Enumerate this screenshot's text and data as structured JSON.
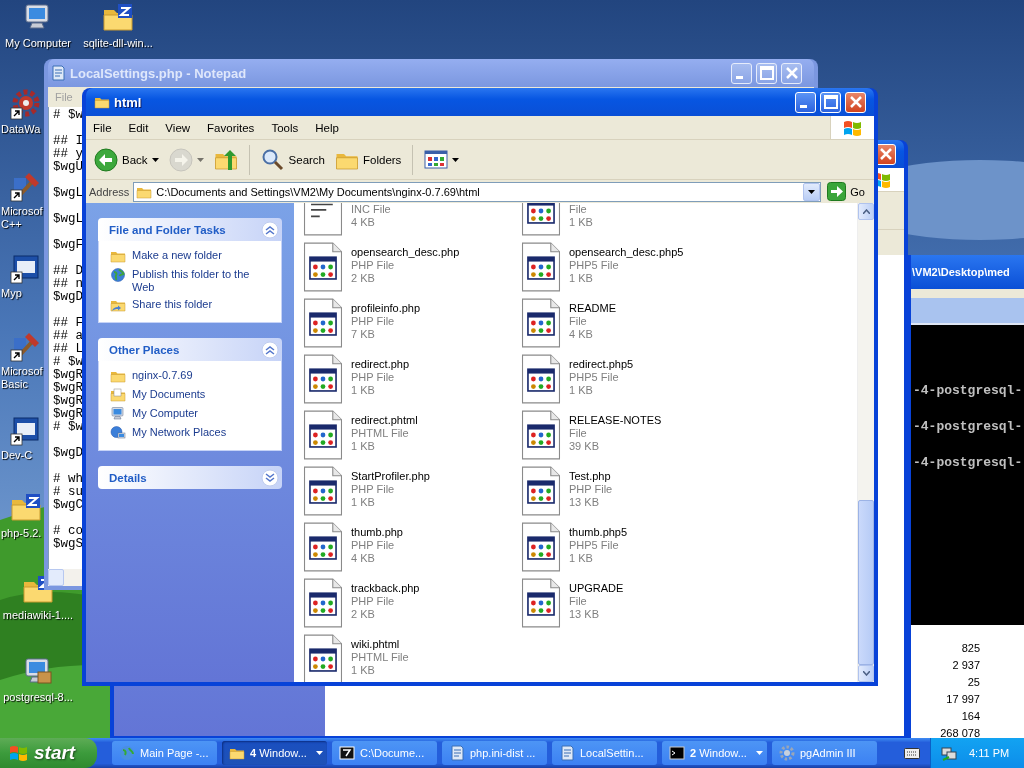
{
  "desktop_icons": [
    {
      "lines": [
        "My Computer"
      ],
      "kind": "computer",
      "shortcut": false
    },
    {
      "lines": [
        "sqlite-dll-win..."
      ],
      "kind": "archive",
      "shortcut": false
    },
    {
      "lines": [
        "DataWa"
      ],
      "kind": "gear",
      "shortcut": true
    },
    {
      "lines": [
        "Microsof",
        "C++"
      ],
      "kind": "tools",
      "shortcut": true
    },
    {
      "lines": [
        "Myp"
      ],
      "kind": "app",
      "shortcut": true
    },
    {
      "lines": [
        "Microsof",
        "Basic"
      ],
      "kind": "tools",
      "shortcut": true
    },
    {
      "lines": [
        "Dev-C"
      ],
      "kind": "app",
      "shortcut": true
    },
    {
      "lines": [
        "php-5.2."
      ],
      "kind": "archive",
      "shortcut": false
    },
    {
      "lines": [
        "mediawiki-1...."
      ],
      "kind": "archive",
      "shortcut": false
    },
    {
      "lines": [
        "postgresql-8..."
      ],
      "kind": "installer",
      "shortcut": false
    }
  ],
  "notepad": {
    "title": "LocalSettings.php - Notepad",
    "active": false,
    "menu": [
      "File"
    ],
    "blocks": [
      [
        "# $w"
      ],
      [
        "## I",
        "## y",
        "$wgU"
      ],
      [
        "$wgL"
      ],
      [
        "$wgL"
      ],
      [
        "$wgF"
      ],
      [
        "## D",
        "## n",
        "$wgD"
      ],
      [
        "## F",
        "## a",
        "## L",
        "# $w",
        "$wgR",
        "$wgR",
        "$wgR",
        "$wgR",
        "# $w"
      ],
      [
        "$wgD"
      ],
      [
        "# wh",
        "# su",
        "$wgC"
      ],
      [
        "# co",
        "$wgS"
      ]
    ]
  },
  "explorer": {
    "title": "html",
    "active": true,
    "menu": [
      "File",
      "Edit",
      "View",
      "Favorites",
      "Tools",
      "Help"
    ],
    "toolbar": [
      {
        "kind": "back",
        "label": "Back",
        "disabled": false
      },
      {
        "kind": "forward",
        "disabled": true
      },
      {
        "kind": "up",
        "disabled": false
      },
      {
        "kind": "search",
        "label": "Search",
        "disabled": false
      },
      {
        "kind": "folders",
        "label": "Folders",
        "disabled": false
      },
      {
        "kind": "views",
        "disabled": false
      }
    ],
    "address": {
      "label": "Address",
      "value": "C:\\Documents and Settings\\VM2\\My Documents\\nginx-0.7.69\\html",
      "go": "Go"
    },
    "task_panels": [
      {
        "title": "File and Folder Tasks",
        "expanded": true,
        "items": [
          {
            "label": "Make a new folder",
            "kind": "new-folder"
          },
          {
            "label": "Publish this folder to the Web",
            "kind": "globe"
          },
          {
            "label": "Share this folder",
            "kind": "share"
          }
        ]
      },
      {
        "title": "Other Places",
        "expanded": true,
        "items": [
          {
            "label": "nginx-0.7.69",
            "kind": "folder"
          },
          {
            "label": "My Documents",
            "kind": "documents"
          },
          {
            "label": "My Computer",
            "kind": "computer"
          },
          {
            "label": "My Network Places",
            "kind": "network"
          }
        ]
      },
      {
        "title": "Details",
        "expanded": false
      }
    ],
    "files": [
      {
        "type": "INC File",
        "size": "4 KB",
        "kind": "text"
      },
      {
        "type": "File",
        "size": "1 KB",
        "kind": "app"
      },
      {
        "name": "opensearch_desc.php",
        "type": "PHP File",
        "size": "2 KB",
        "kind": "app"
      },
      {
        "name": "opensearch_desc.php5",
        "type": "PHP5 File",
        "size": "1 KB",
        "kind": "app"
      },
      {
        "name": "profileinfo.php",
        "type": "PHP File",
        "size": "7 KB",
        "kind": "app"
      },
      {
        "name": "README",
        "type": "File",
        "size": "4 KB",
        "kind": "app"
      },
      {
        "name": "redirect.php",
        "type": "PHP File",
        "size": "1 KB",
        "kind": "app"
      },
      {
        "name": "redirect.php5",
        "type": "PHP5 File",
        "size": "1 KB",
        "kind": "app"
      },
      {
        "name": "redirect.phtml",
        "type": "PHTML File",
        "size": "1 KB",
        "kind": "app"
      },
      {
        "name": "RELEASE-NOTES",
        "type": "File",
        "size": "39 KB",
        "kind": "app"
      },
      {
        "name": "StartProfiler.php",
        "type": "PHP File",
        "size": "1 KB",
        "kind": "app"
      },
      {
        "name": "Test.php",
        "type": "PHP File",
        "size": "13 KB",
        "kind": "app"
      },
      {
        "name": "thumb.php",
        "type": "PHP File",
        "size": "4 KB",
        "kind": "app"
      },
      {
        "name": "thumb.php5",
        "type": "PHP5 File",
        "size": "1 KB",
        "kind": "app"
      },
      {
        "name": "trackback.php",
        "type": "PHP File",
        "size": "2 KB",
        "kind": "app"
      },
      {
        "name": "UPGRADE",
        "type": "File",
        "size": "13 KB",
        "kind": "app"
      },
      {
        "name": "wiki.phtml",
        "type": "PHTML File",
        "size": "1 KB",
        "kind": "app"
      }
    ]
  },
  "console": {
    "title": "\\VM2\\Desktop\\med",
    "lines": [
      "-4-postgresql-",
      "-4-postgresql-",
      "-4-postgresql-"
    ]
  },
  "side_list": {
    "values": [
      "825",
      "2 937",
      "25",
      "17 997",
      "164",
      "268 078"
    ]
  },
  "taskbar": {
    "start": "start",
    "items": [
      {
        "label": "Main Page -...",
        "kind": "browser",
        "selected": false,
        "grouped": false
      },
      {
        "label": "**4** Window...",
        "kind": "folder",
        "selected": true,
        "grouped": true
      },
      {
        "label": "C:\\Docume...",
        "kind": "archive",
        "selected": false,
        "grouped": false
      },
      {
        "label": "php.ini-dist ...",
        "kind": "notepad",
        "selected": false,
        "grouped": false
      },
      {
        "label": "LocalSettin...",
        "kind": "notepad",
        "selected": false,
        "grouped": false
      },
      {
        "label": "**2** Window...",
        "kind": "console",
        "selected": false,
        "grouped": true
      },
      {
        "label": "pgAdmin III",
        "kind": "app",
        "selected": false,
        "grouped": false
      }
    ],
    "clock": "4:11 PM"
  }
}
